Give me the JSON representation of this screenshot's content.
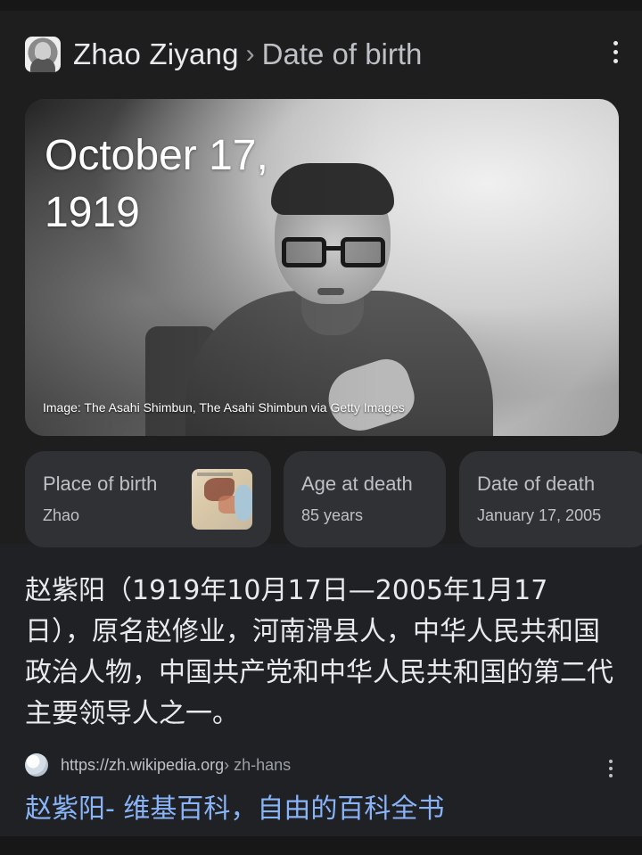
{
  "header": {
    "entity": "Zhao Ziyang",
    "separator": "›",
    "attribute": "Date of birth",
    "menu_icon": "more-vert-icon"
  },
  "hero": {
    "date_text": "October 17,\n1919",
    "credit": "Image: The Asahi Shimbun, The Asahi Shimbun via Getty Images"
  },
  "chips": [
    {
      "label": "Place of birth",
      "value": "Zhao",
      "thumb": "map-thumbnail"
    },
    {
      "label": "Age at death",
      "value": "85 years"
    },
    {
      "label": "Date of death",
      "value": "January 17, 2005"
    }
  ],
  "snippet": "赵紫阳（1919年10月17日—2005年1月17日），原名赵修业，河南滑县人，中华人民共和国政治人物，中国共产党和中华人民共和国的第二代主要领导人之一。",
  "source": {
    "url": "https://zh.wikipedia.org",
    "path": " › zh-hans",
    "title": "赵紫阳- 维基百科，自由的百科全书",
    "favicon": "globe-icon"
  },
  "colors": {
    "background": "#202124",
    "card": "#1e1e1e",
    "chip": "#303134",
    "link": "#8ab4f8",
    "text_primary": "#e8eaed",
    "text_secondary": "#bdc1c6"
  }
}
